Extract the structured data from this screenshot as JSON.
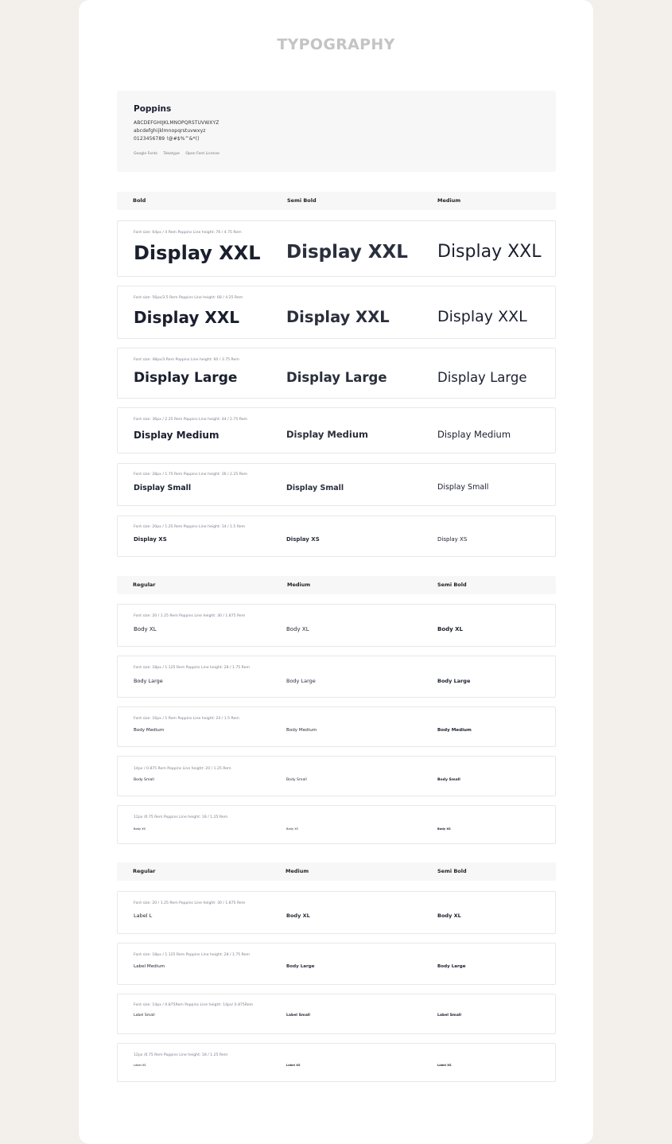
{
  "page": {
    "title": "TYPOGRAPHY"
  },
  "font": {
    "name": "Poppins",
    "uppercase": "ABCDEFGHIJKLMNOPQRSTUVWXYZ",
    "lowercase": "abcdefghijklmnopqrstuvwxyz",
    "symbols": "0123456789 !@#$%^&*()",
    "links": [
      "Google Fonts",
      "Tokotype",
      "Open Font License"
    ]
  },
  "display": {
    "headers": [
      "Bold",
      "Semi Bold",
      "Medium"
    ],
    "rows": [
      {
        "meta": "Font size: 64px / 4 Rem   Poppins   Line height: 76 / 4.75 Rem",
        "samples": [
          "Display XXL",
          "Display XXL",
          "Display XXL"
        ]
      },
      {
        "meta": "Font size: 56px/3.5 Rem   Poppins   Line height: 68 / 4.25 Rem",
        "samples": [
          "Display XXL",
          "Display XXL",
          "Display XXL"
        ]
      },
      {
        "meta": "Font size: 48px/3 Rem   Poppins   Line height: 60 / 3.75 Rem",
        "samples": [
          "Display Large",
          "Display Large",
          "Display Large"
        ]
      },
      {
        "meta": "Font size: 36px / 2.25  Rem   Poppins   Line height: 44 / 2.75 Rem",
        "samples": [
          "Display Medium",
          "Display Medium",
          "Display Medium"
        ]
      },
      {
        "meta": "Font size: 28px  / 1.75 Rem   Poppins   Line height: 36 / 2.25 Rem",
        "samples": [
          "Display Small",
          "Display Small",
          "Display Small"
        ]
      },
      {
        "meta": "Font size: 20px / 1.25 Rem   Poppins   Line height: 14 / 1.5 Rem",
        "samples": [
          "Display XS",
          "Display XS",
          "Display XS"
        ]
      }
    ]
  },
  "body": {
    "headers": [
      "Regular",
      "Medium",
      "Semi Bold"
    ],
    "rows": [
      {
        "meta": "Font size: 20 / 1.25 Rem   Poppins   Line height: 30 / 1.875 Rem",
        "samples": [
          "Body XL",
          "Body XL",
          "Body XL"
        ]
      },
      {
        "meta": "Font size: 18px / 1.125 Rem   Poppins   Line height: 28 / 1.75 Rem",
        "samples": [
          "Body Large",
          "Body Large",
          "Body Large"
        ]
      },
      {
        "meta": "Font size: 16px / 1 Rem   Poppins   Line height: 24 / 1.5 Rem",
        "samples": [
          "Body Medium",
          "Body Medium",
          "Body Medium"
        ]
      },
      {
        "meta": "14px / 0.875 Rem   Poppins   Line height: 20 / 1.25 Rem",
        "samples": [
          "Body Small",
          "Body Small",
          "Body Small"
        ]
      },
      {
        "meta": "12px /0.75 Rem   Poppins   Line height: 18 / 1.25 Rem",
        "samples": [
          "Body XS",
          "Body XS",
          "Body XS"
        ]
      }
    ]
  },
  "label": {
    "headers": [
      "Regular",
      "Medium",
      "Semi Bold"
    ],
    "rows": [
      {
        "meta": "Font size: 20 / 1.25 Rem   Poppins   Line height: 30 / 1.875 Rem",
        "samples": [
          "Label L",
          "Body XL",
          "Body XL"
        ]
      },
      {
        "meta": "Font size: 18px / 1.125 Rem   Poppins   Line height: 28 / 1.75 Rem",
        "samples": [
          "Label Medium",
          "Body Large",
          "Body Large"
        ]
      },
      {
        "meta": "Font size: 14px / 0.875Rem   Poppins   Line height: 14px/ 0.875Rem",
        "samples": [
          "Label Small",
          "Label Small",
          "Label Small"
        ]
      },
      {
        "meta": "12px /0.75 Rem   Poppins   Line height: 18 / 1.25 Rem",
        "samples": [
          "Label XS",
          "Label XS",
          "Label XS"
        ]
      }
    ]
  }
}
